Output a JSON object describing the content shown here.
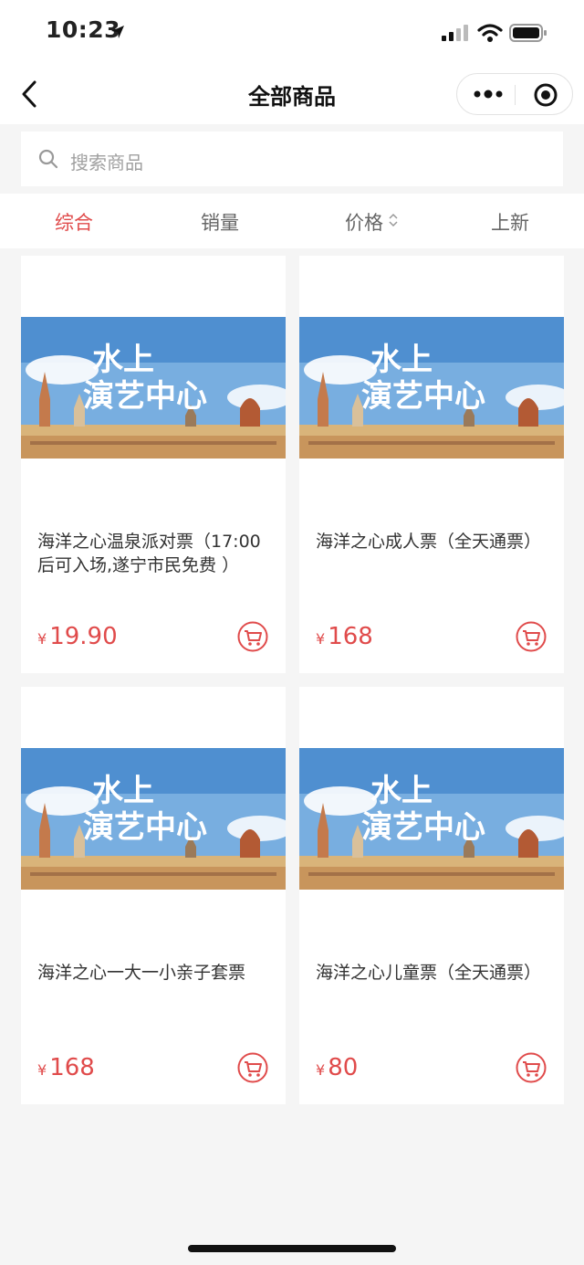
{
  "status_bar": {
    "time": "10:23"
  },
  "nav": {
    "title": "全部商品"
  },
  "search": {
    "placeholder": "搜索商品"
  },
  "sort_tabs": [
    "综合",
    "销量",
    "价格",
    "上新"
  ],
  "image_text": {
    "line1": "水上",
    "line2": "演艺中心"
  },
  "colors": {
    "accent": "#e04b4b",
    "page_bg": "#f5f5f5"
  },
  "products": [
    {
      "title": "海洋之心温泉派对票（17:00后可入场,遂宁市民免费 ）",
      "currency": "¥",
      "price": "19.90"
    },
    {
      "title": "海洋之心成人票（全天通票）",
      "currency": "¥",
      "price": "168"
    },
    {
      "title": "海洋之心一大一小亲子套票",
      "currency": "¥",
      "price": "168"
    },
    {
      "title": "海洋之心儿童票（全天通票）",
      "currency": "¥",
      "price": "80"
    }
  ]
}
